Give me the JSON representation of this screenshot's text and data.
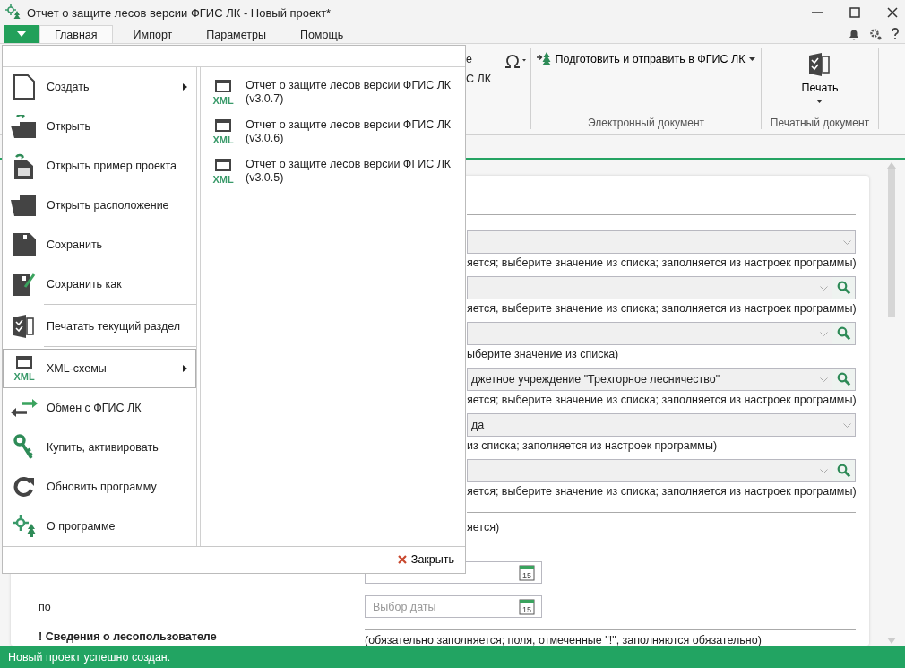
{
  "window": {
    "title": "Отчет о защите лесов версии ФГИС ЛК - Новый проект*"
  },
  "tabs": [
    {
      "label": "Главная",
      "selected": true
    },
    {
      "label": "Импорт",
      "selected": false
    },
    {
      "label": "Параметры",
      "selected": false
    },
    {
      "label": "Помощь",
      "selected": false
    }
  ],
  "ribbon": {
    "group_1": {
      "text_1": "е",
      "text_2": "С ЛК"
    },
    "electronic": {
      "button": "Подготовить и отправить в ФГИС ЛК",
      "label": "Электронный документ"
    },
    "print": {
      "button": "Печать",
      "label": "Печатный документ"
    }
  },
  "menu": {
    "items": [
      {
        "kind": "item",
        "label": "Создать",
        "submenu": true,
        "selected": false
      },
      {
        "kind": "item",
        "label": "Открыть",
        "submenu": false,
        "selected": false
      },
      {
        "kind": "item",
        "label": "Открыть пример проекта",
        "submenu": false,
        "selected": false
      },
      {
        "kind": "item",
        "label": "Открыть расположение",
        "submenu": false,
        "selected": false
      },
      {
        "kind": "item",
        "label": "Сохранить",
        "submenu": false,
        "selected": false
      },
      {
        "kind": "item",
        "label": "Сохранить как",
        "submenu": false,
        "selected": false
      },
      {
        "kind": "separator"
      },
      {
        "kind": "item",
        "label": "Печатать текущий раздел",
        "submenu": false,
        "selected": false
      },
      {
        "kind": "separator"
      },
      {
        "kind": "item",
        "label": "XML-схемы",
        "submenu": true,
        "selected": true,
        "icon_text": "XML"
      },
      {
        "kind": "item",
        "label": "Обмен с ФГИС ЛК",
        "submenu": false,
        "selected": false
      },
      {
        "kind": "item",
        "label": "Купить, активировать",
        "submenu": false,
        "selected": false
      },
      {
        "kind": "item",
        "label": "Обновить программу",
        "submenu": false,
        "selected": false
      },
      {
        "kind": "item",
        "label": "О программе",
        "submenu": false,
        "selected": false
      }
    ],
    "submenu": [
      {
        "label": "Отчет о защите лесов версии ФГИС ЛК (v3.0.7)",
        "icon_text": "XML"
      },
      {
        "label": "Отчет о защите лесов версии ФГИС ЛК (v3.0.6)",
        "icon_text": "XML"
      },
      {
        "label": "Отчет о защите лесов версии ФГИС ЛК (v3.0.5)",
        "icon_text": "XML"
      }
    ],
    "close": "Закрыть"
  },
  "form": {
    "fields": [
      {
        "kind": "select",
        "search": false,
        "hint": "яется; выберите значение из списка; заполняется из настроек программы)"
      },
      {
        "kind": "select",
        "search": true,
        "hint": "яется, выберите значение из списка; заполняется из настроек программы)"
      },
      {
        "kind": "select",
        "search": true,
        "hint": "ыберите значение из списка)"
      },
      {
        "kind": "select",
        "search": true,
        "value": "джетное учреждение \"Трехгорное лесничество\"",
        "hint": "яется; выберите значение из списка; заполняется из настроек программы)"
      },
      {
        "kind": "select",
        "search": false,
        "value": "да",
        "hint": "из списка; заполняется из настроек программы)"
      },
      {
        "kind": "select",
        "search": true,
        "hint": "яется; выберите значение из списка; заполняется из настроек программы)"
      }
    ],
    "note": "яется)",
    "dates": [
      {
        "icon_text": "15"
      },
      {
        "label": "по",
        "placeholder": "Выбор даты",
        "icon_text": "15"
      }
    ],
    "section": {
      "title": "! Сведения о лесопользователе",
      "hint": "(обязательно заполняется; поля, отмеченные \"!\", заполняются обязательно)"
    }
  },
  "status_bar": "Новый проект успешно создан."
}
